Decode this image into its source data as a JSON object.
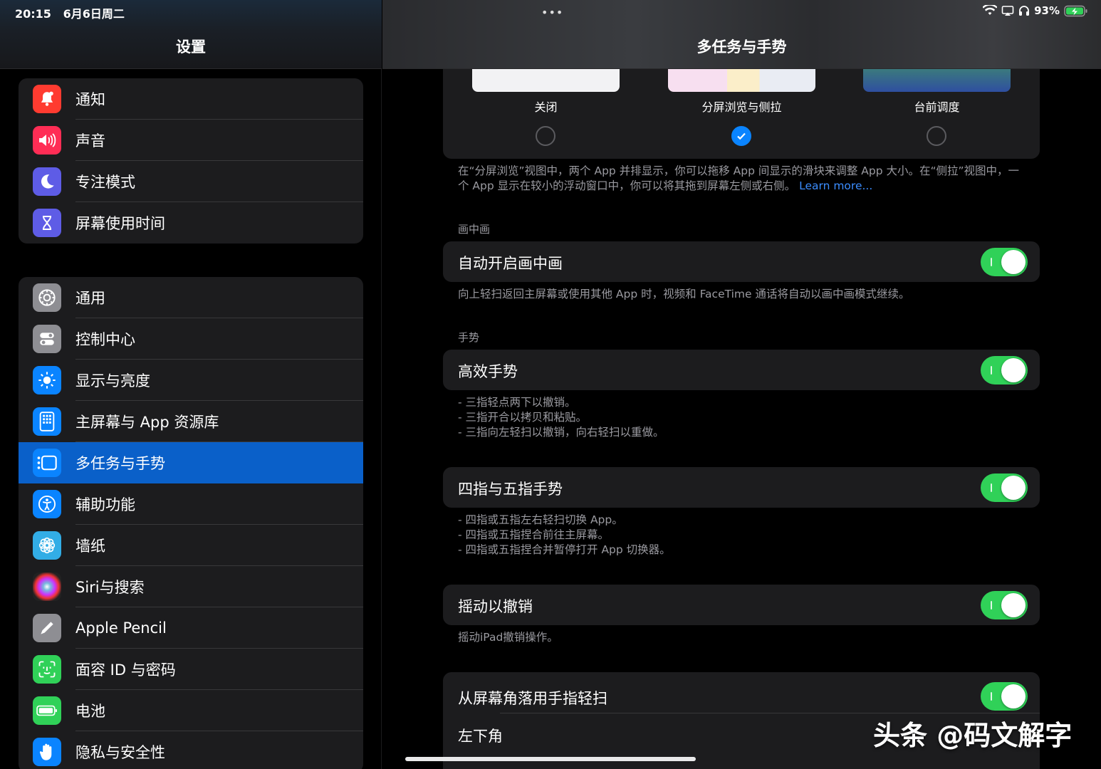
{
  "status_bar": {
    "time": "20:15",
    "date": "6月6日周二",
    "battery": "93%",
    "dots": "•••"
  },
  "sidebar": {
    "title": "设置",
    "group1": [
      {
        "label": "通知",
        "icon": "bell-icon",
        "color": "#ff3b30"
      },
      {
        "label": "声音",
        "icon": "speaker-icon",
        "color": "#ff2d55"
      },
      {
        "label": "专注模式",
        "icon": "moon-icon",
        "color": "#5e5ce6"
      },
      {
        "label": "屏幕使用时间",
        "icon": "hourglass-icon",
        "color": "#5e5ce6"
      }
    ],
    "group2": [
      {
        "label": "通用",
        "icon": "gear-icon",
        "color": "#8e8e93"
      },
      {
        "label": "控制中心",
        "icon": "switches-icon",
        "color": "#8e8e93"
      },
      {
        "label": "显示与亮度",
        "icon": "sun-icon",
        "color": "#0a84ff"
      },
      {
        "label": "主屏幕与 App 资源库",
        "icon": "home-screen-icon",
        "color": "#0a84ff"
      },
      {
        "label": "多任务与手势",
        "icon": "multitask-icon",
        "color": "#0a84ff"
      },
      {
        "label": "辅助功能",
        "icon": "accessibility-icon",
        "color": "#0a84ff"
      },
      {
        "label": "墙纸",
        "icon": "flower-icon",
        "color": "#32ade6"
      },
      {
        "label": "Siri与搜索",
        "icon": "siri-icon",
        "color": "#222"
      },
      {
        "label": "Apple Pencil",
        "icon": "pencil-icon",
        "color": "#8e8e93"
      },
      {
        "label": "面容 ID 与密码",
        "icon": "faceid-icon",
        "color": "#30d158"
      },
      {
        "label": "电池",
        "icon": "battery-icon",
        "color": "#30d158"
      },
      {
        "label": "隐私与安全性",
        "icon": "hand-icon",
        "color": "#0a84ff"
      }
    ]
  },
  "main": {
    "title": "多任务与手势",
    "modes": [
      {
        "label": "关闭",
        "checked": false
      },
      {
        "label": "分屏浏览与侧拉",
        "checked": true
      },
      {
        "label": "台前调度",
        "checked": false
      }
    ],
    "modes_desc": "在“分屏浏览”视图中，两个 App 并排显示，你可以拖移 App 间显示的滑块来调整 App 大小。在“侧拉”视图中，一个 App 显示在较小的浮动窗口中，你可以将其拖到屏幕左侧或右侧。",
    "learn_more": "Learn more...",
    "pip_header": "画中画",
    "pip_toggle": "自动开启画中画",
    "pip_desc": "向上轻扫返回主屏幕或使用其他 App 时，视频和 FaceTime 通话将自动以画中画模式继续。",
    "gestures_header": "手势",
    "gesture_toggle": "高效手势",
    "gesture_desc": [
      "- 三指轻点两下以撤销。",
      "- 三指开合以拷贝和粘贴。",
      "- 三指向左轻扫以撤销，向右轻扫以重做。"
    ],
    "four_five_toggle": "四指与五指手势",
    "four_five_desc": [
      "- 四指或五指左右轻扫切换 App。",
      "- 四指或五指捏合前往主屏幕。",
      "- 四指或五指捏合并暂停打开 App 切换器。"
    ],
    "shake_toggle": "摇动以撤销",
    "shake_desc": "摇动iPad撤销操作。",
    "corner_toggle": "从屏幕角落用手指轻扫",
    "bottom_left": "左下角"
  },
  "watermark": "头条 @码文解字",
  "colors": {
    "accent": "#0a84ff",
    "toggle_on": "#30d158",
    "selected_row": "#0a60c9"
  }
}
